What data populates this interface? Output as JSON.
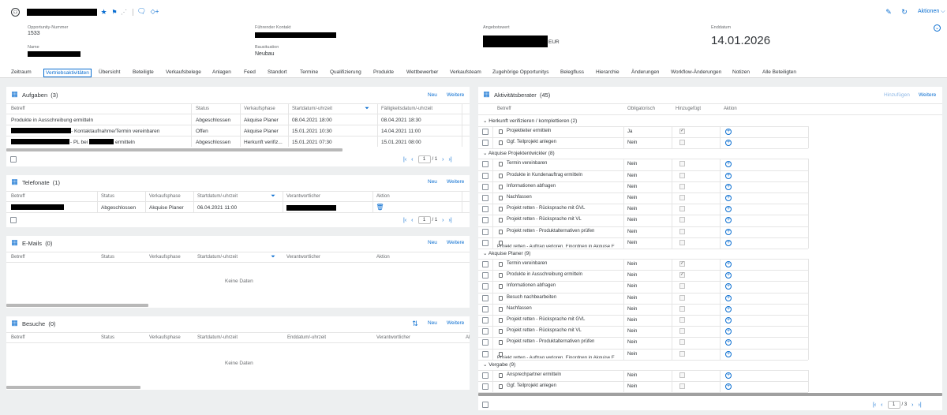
{
  "header": {
    "opp_nr_label": "Opportunity-Nummer",
    "opp_nr": "1533",
    "name_label": "Name",
    "fuehrender_kontakt_label": "Führender Kontakt",
    "bausituation_label": "Bausituation",
    "bausituation": "Neubau",
    "angebotswert_label": "Angebotswert",
    "currency": "EUR",
    "enddatum_label": "Enddatum",
    "enddatum": "14.01.2026",
    "aktionen": "Aktionen"
  },
  "tabs": [
    "Zeitraum",
    "Vertriebsaktivitäten",
    "Übersicht",
    "Beteiligte",
    "Verkaufsbelege",
    "Anlagen",
    "Feed",
    "Standort",
    "Termine",
    "Qualifizierung",
    "Produkte",
    "Wettbewerber",
    "Verkaufsteam",
    "Zugehörige Opportunitys",
    "Belegfluss",
    "Hierarchie",
    "Änderungen",
    "Workflow-Änderungen",
    "Notizen",
    "Alle Beteiligten"
  ],
  "aufgaben": {
    "title": "Aufgaben",
    "count": "(3)",
    "neu": "Neu",
    "weitere": "Weitere",
    "cols": [
      "Betreff",
      "Status",
      "Verkaufsphase",
      "Startdatum/-uhrzeit",
      "Fälligkeitsdatum/-uhrzeit"
    ],
    "rows": [
      {
        "betreff": "Produkte in Ausschreibung ermitteln",
        "status": "Abgeschlossen",
        "phase": "Akquise Planer",
        "start": "08.04.2021 18:00",
        "faellig": "08.04.2021 18:30"
      },
      {
        "betreff": "- Kontaktaufnahme/Termin vereinbaren",
        "status": "Offen",
        "phase": "Akquise Planer",
        "start": "15.01.2021 10:30",
        "faellig": "14.04.2021 11:00"
      },
      {
        "betreff_a": "- PL bei",
        "betreff_b": "ermitteln",
        "status": "Abgeschlossen",
        "phase": "Herkunft verifiz...",
        "start": "15.01.2021 07:30",
        "faellig": "15.01.2021 08:00"
      }
    ],
    "page": "1",
    "pages": "/ 1"
  },
  "telefonate": {
    "title": "Telefonate",
    "count": "(1)",
    "neu": "Neu",
    "weitere": "Weitere",
    "cols": [
      "Betreff",
      "Status",
      "Verkaufsphase",
      "Startdatum/-uhrzeit",
      "Verantwortlicher",
      "Aktion"
    ],
    "row": {
      "status": "Abgeschlossen",
      "phase": "Akquise Planer",
      "start": "06.04.2021 11:00"
    },
    "page": "1",
    "pages": "/ 1"
  },
  "emails": {
    "title": "E-Mails",
    "count": "(0)",
    "neu": "Neu",
    "weitere": "Weitere",
    "cols": [
      "Betreff",
      "Status",
      "Verkaufsphase",
      "Startdatum/-uhrzeit",
      "Verantwortlicher",
      "Aktion"
    ],
    "empty": "Keine Daten"
  },
  "besuche": {
    "title": "Besuche",
    "count": "(0)",
    "neu": "Neu",
    "weitere": "Weitere",
    "cols": [
      "Betreff",
      "Status",
      "Verkaufsphase",
      "Startdatum/-uhrzeit",
      "Enddatum/-uhrzeit",
      "Verantwortlicher",
      "Al"
    ],
    "empty": "Keine Daten"
  },
  "berater": {
    "title": "Aktivitätsberater",
    "count": "(45)",
    "hinzufuegen": "Hinzufügen",
    "weitere": "Weitere",
    "cols": [
      "Betreff",
      "Obligatorisch",
      "Hinzugefügt",
      "Aktion"
    ],
    "groups": [
      {
        "label": "Herkunft verifizieren / komplettieren (2)",
        "items": [
          {
            "name": "Projektleiter ermitteln",
            "oblig": "Ja",
            "added": true
          },
          {
            "name": "Ggf. Teilprojekt anlegen",
            "oblig": "Nein",
            "added": false
          }
        ]
      },
      {
        "label": "Akquise Projektentwickler (8)",
        "items": [
          {
            "name": "Termin vereinbaren",
            "oblig": "Nein",
            "added": false
          },
          {
            "name": "Produkte in Kundenauftrag ermitteln",
            "oblig": "Nein",
            "added": false
          },
          {
            "name": "Informationen abfragen",
            "oblig": "Nein",
            "added": false
          },
          {
            "name": "Nachfassen",
            "oblig": "Nein",
            "added": false
          },
          {
            "name": "Projekt retten - Rücksprache mit GVL",
            "oblig": "Nein",
            "added": false
          },
          {
            "name": "Projekt retten - Rücksprache mit VL",
            "oblig": "Nein",
            "added": false
          },
          {
            "name": "Projekt retten - Produktalternativen prüfen",
            "oblig": "Nein",
            "added": false
          },
          {
            "name": "Projekt retten - Auftrag verloren, Einordnen in Akquise E",
            "oblig": "Nein",
            "added": false,
            "cut": true
          }
        ]
      },
      {
        "label": "Akquise Planer (9)",
        "items": [
          {
            "name": "Termin vereinbaren",
            "oblig": "Nein",
            "added": true
          },
          {
            "name": "Produkte in Ausschreibung ermitteln",
            "oblig": "Nein",
            "added": true
          },
          {
            "name": "Informationen abfragen",
            "oblig": "Nein",
            "added": false
          },
          {
            "name": "Besuch nachbearbeiten",
            "oblig": "Nein",
            "added": false
          },
          {
            "name": "Nachfassen",
            "oblig": "Nein",
            "added": false
          },
          {
            "name": "Projekt retten - Rücksprache mit GVL",
            "oblig": "Nein",
            "added": false
          },
          {
            "name": "Projekt retten - Rücksprache mit VL",
            "oblig": "Nein",
            "added": false
          },
          {
            "name": "Projekt retten - Produktalternativen prüfen",
            "oblig": "Nein",
            "added": false
          },
          {
            "name": "Projekt retten - Auftrag verloren, Einordnen in Akquise E",
            "oblig": "Nein",
            "added": false,
            "cut": true
          }
        ]
      },
      {
        "label": "Vergabe (9)",
        "items": [
          {
            "name": "Ansprechpartner ermitteln",
            "oblig": "Nein",
            "added": false
          },
          {
            "name": "Ggf. Teilprojekt anlegen",
            "oblig": "Nein",
            "added": false
          }
        ]
      }
    ],
    "page": "1",
    "pages": "/ 3"
  }
}
